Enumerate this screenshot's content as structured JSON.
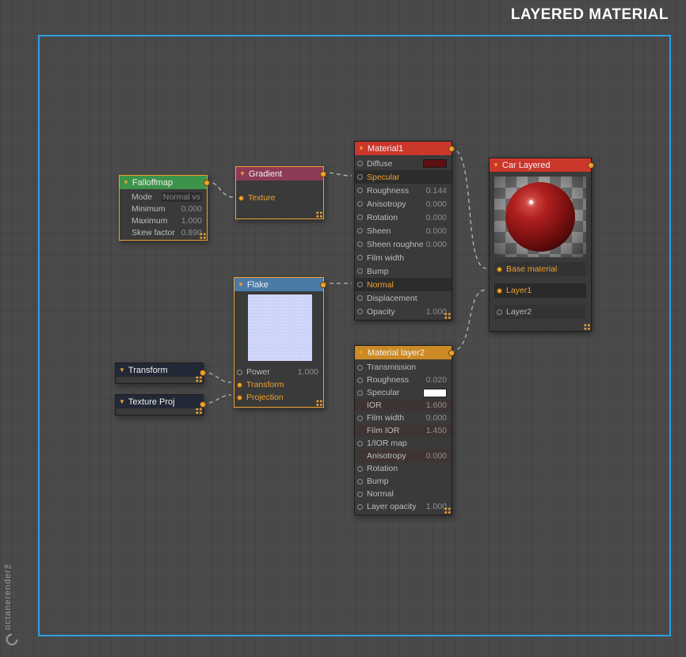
{
  "window": {
    "title": "LAYERED MATERIAL",
    "brand": "octanerender™"
  },
  "colors": {
    "accent_orange": "#f0a030",
    "frame_blue": "#2da0e0",
    "material_red": "#cc372b",
    "flake_blue": "#4a7aa5",
    "falloff_green": "#3c9349",
    "gradient_maroon": "#8d3a55",
    "layer2_amber": "#cc8a26",
    "transform_navy": "#232836"
  },
  "nodes": {
    "falloffmap": {
      "title": "Falloffmap",
      "rows": [
        {
          "label": "Mode",
          "value": "Normal vs"
        },
        {
          "label": "Minimum",
          "value": "0.000"
        },
        {
          "label": "Maximum",
          "value": "1.000"
        },
        {
          "label": "Skew factor",
          "value": "0.890"
        }
      ]
    },
    "gradient": {
      "title": "Gradient",
      "rows": [
        {
          "label": "Texture"
        }
      ]
    },
    "material1": {
      "title": "Material1",
      "rows": [
        {
          "label": "Diffuse"
        },
        {
          "label": "Specular"
        },
        {
          "label": "Roughness",
          "value": "0.144"
        },
        {
          "label": "Anisotropy",
          "value": "0.000"
        },
        {
          "label": "Rotation",
          "value": "0.000"
        },
        {
          "label": "Sheen",
          "value": "0.000"
        },
        {
          "label": "Sheen roughness",
          "value": "0.000"
        },
        {
          "label": "Film width"
        },
        {
          "label": "Bump"
        },
        {
          "label": "Normal"
        },
        {
          "label": "Displacement"
        },
        {
          "label": "Opacity",
          "value": "1.000"
        }
      ]
    },
    "car_layered": {
      "title": "Car Layered",
      "rows": [
        {
          "label": "Base material"
        },
        {
          "label": "Layer1"
        },
        {
          "label": "Layer2"
        }
      ]
    },
    "flake": {
      "title": "Flake",
      "rows": [
        {
          "label": "Power",
          "value": "1.000"
        },
        {
          "label": "Transform"
        },
        {
          "label": "Projection"
        }
      ]
    },
    "transform": {
      "title": "Transform"
    },
    "texture_proj": {
      "title": "Texture Proj"
    },
    "material_layer2": {
      "title": "Material layer2",
      "rows": [
        {
          "label": "Transmission"
        },
        {
          "label": "Roughness",
          "value": "0.020"
        },
        {
          "label": "Specular"
        },
        {
          "label": "IOR",
          "value": "1.600"
        },
        {
          "label": "Film width",
          "value": "0.000"
        },
        {
          "label": "Film IOR",
          "value": "1.450"
        },
        {
          "label": "1/IOR map"
        },
        {
          "label": "Anisotropy",
          "value": "0.000"
        },
        {
          "label": "Rotation"
        },
        {
          "label": "Bump"
        },
        {
          "label": "Normal"
        },
        {
          "label": "Layer opacity",
          "value": "1.000"
        }
      ]
    }
  }
}
